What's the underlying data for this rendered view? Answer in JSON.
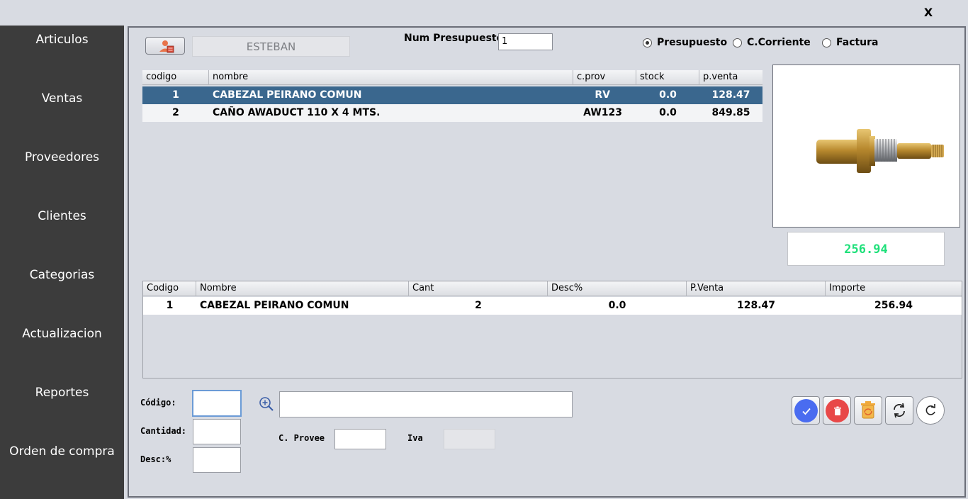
{
  "window": {
    "close_label": "X"
  },
  "sidebar": {
    "items": [
      {
        "label": "Articulos"
      },
      {
        "label": "Ventas"
      },
      {
        "label": "Proveedores"
      },
      {
        "label": "Clientes"
      },
      {
        "label": "Categorias"
      },
      {
        "label": "Actualizacion"
      },
      {
        "label": "Reportes"
      },
      {
        "label": "Orden de compra"
      }
    ]
  },
  "header": {
    "user_name": "ESTEBAN",
    "num_label": "Num Presupuesto",
    "num_value": "1",
    "doc_types": [
      {
        "label": "Presupuesto",
        "selected": true
      },
      {
        "label": "C.Corriente",
        "selected": false
      },
      {
        "label": "Factura",
        "selected": false
      }
    ]
  },
  "articles_table": {
    "columns": [
      "codigo",
      "nombre",
      "c.prov",
      "stock",
      "p.venta"
    ],
    "rows": [
      {
        "codigo": "1",
        "nombre": "CABEZAL PEIRANO COMUN",
        "cprov": "RV",
        "stock": "0.0",
        "pventa": "128.47",
        "selected": true
      },
      {
        "codigo": "2",
        "nombre": "CAÑO AWADUCT 110 X 4 MTS.",
        "cprov": "AW123",
        "stock": "0.0",
        "pventa": "849.85",
        "selected": false
      }
    ]
  },
  "total": "256.94",
  "detail_table": {
    "columns": [
      "Codigo",
      "Nombre",
      "Cant",
      "Desc%",
      "P.Venta",
      "Importe"
    ],
    "rows": [
      {
        "codigo": "1",
        "nombre": "CABEZAL PEIRANO COMUN",
        "cant": "2",
        "desc": "0.0",
        "pventa": "128.47",
        "importe": "256.94"
      }
    ]
  },
  "form": {
    "codigo_label": "Código:",
    "cantidad_label": "Cantidad:",
    "desc_label": "Desc:%",
    "cprovee_label": "C. Provee",
    "iva_label": "Iva",
    "codigo_value": "",
    "cantidad_value": "",
    "desc_value": "",
    "search_value": "",
    "cprovee_value": "",
    "iva_value": ""
  },
  "colors": {
    "sidebar_bg": "#3c3c3c",
    "selected_row": "#3a678e",
    "total_text": "#1ee07a",
    "confirm": "#4a6cf0",
    "delete": "#e84848"
  },
  "icons": [
    "user-card-icon",
    "zoom-in-icon",
    "check-icon",
    "trash-icon",
    "recycle-bin-icon",
    "sync-icon",
    "refresh-icon",
    "faucet-valve-product-image"
  ]
}
